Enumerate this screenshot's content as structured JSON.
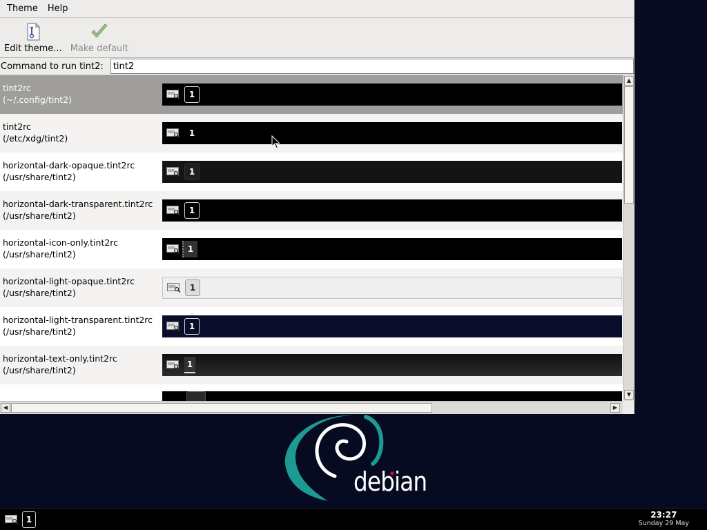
{
  "window": {
    "menu": [
      "Theme",
      "Help"
    ],
    "toolbar": {
      "edit_label": "Edit theme...",
      "default_label": "Make default"
    },
    "command": {
      "label": "Command to run tint2:",
      "value": "tint2"
    }
  },
  "themes": [
    {
      "name": "tint2rc",
      "path": "(~/.config/tint2)",
      "desktop": "1",
      "selected": true
    },
    {
      "name": "tint2rc",
      "path": "(/etc/xdg/tint2)",
      "desktop": "1"
    },
    {
      "name": "horizontal-dark-opaque.tint2rc",
      "path": "(/usr/share/tint2)",
      "desktop": "1"
    },
    {
      "name": "horizontal-dark-transparent.tint2rc",
      "path": "(/usr/share/tint2)",
      "desktop": "1"
    },
    {
      "name": "horizontal-icon-only.tint2rc",
      "path": "(/usr/share/tint2)",
      "desktop": "1"
    },
    {
      "name": "horizontal-light-opaque.tint2rc",
      "path": "(/usr/share/tint2)",
      "desktop": "1"
    },
    {
      "name": "horizontal-light-transparent.tint2rc",
      "path": "(/usr/share/tint2)",
      "desktop": "1"
    },
    {
      "name": "horizontal-text-only.tint2rc",
      "path": "(/usr/share/tint2)",
      "desktop": "1"
    }
  ],
  "wallpaper": {
    "logo_text": "debian",
    "swirl_color": "#1d9b93",
    "accent_color": "#d70751"
  },
  "taskbar": {
    "desktop": "1",
    "clock_time": "23:27",
    "clock_date": "Sunday 29 May"
  },
  "colors": {
    "desktop_background": "#070b22",
    "selected_row": "#9f9e9b"
  }
}
